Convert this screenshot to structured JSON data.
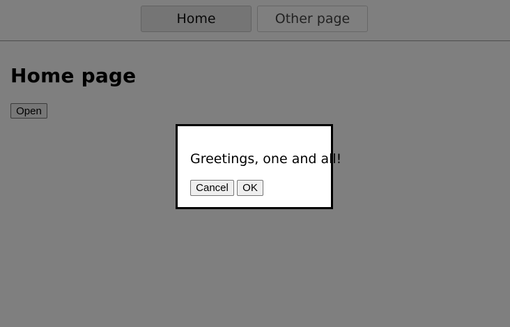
{
  "nav": {
    "tabs": [
      {
        "label": "Home",
        "active": true
      },
      {
        "label": "Other page",
        "active": false
      }
    ]
  },
  "main": {
    "title": "Home page",
    "open_button_label": "Open"
  },
  "dialog": {
    "message": "Greetings, one and all!",
    "cancel_label": "Cancel",
    "ok_label": "OK"
  },
  "colors": {
    "overlay": "#808080",
    "dialog_border": "#000000",
    "dialog_background": "#ffffff"
  }
}
